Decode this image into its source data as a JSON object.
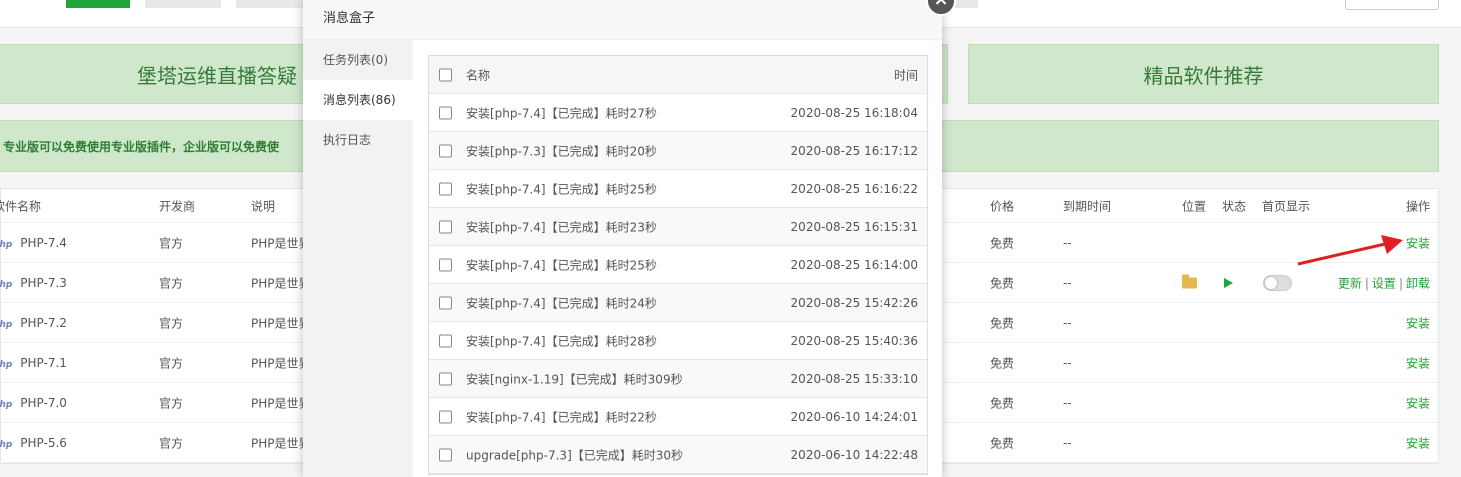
{
  "banners": {
    "left": "堡塔运维直播答疑",
    "right": "精品软件推荐"
  },
  "notice": "专业版可以免费使用专业版插件，企业版可以免费使",
  "soft_table": {
    "headers": {
      "name": "软件名称",
      "dev": "开发商",
      "desc": "说明",
      "price": "价格",
      "expire": "到期时间",
      "position": "位置",
      "status": "状态",
      "home": "首页显示",
      "op": "操作"
    },
    "rows": [
      {
        "logo": "php",
        "name": "PHP-7.4",
        "dev": "官方",
        "desc": "PHP是世界",
        "price": "免费",
        "expire": "--",
        "op": "安装"
      },
      {
        "logo": "php",
        "name": "PHP-7.3",
        "dev": "官方",
        "desc": "PHP是世界",
        "price": "免费",
        "expire": "--",
        "op_update": "更新",
        "op_settings": "设置",
        "op_uninstall": "卸载",
        "sep": "|"
      },
      {
        "logo": "php",
        "name": "PHP-7.2",
        "dev": "官方",
        "desc": "PHP是世界",
        "price": "免费",
        "expire": "--",
        "op": "安装"
      },
      {
        "logo": "php",
        "name": "PHP-7.1",
        "dev": "官方",
        "desc": "PHP是世界",
        "price": "免费",
        "expire": "--",
        "op": "安装"
      },
      {
        "logo": "php",
        "name": "PHP-7.0",
        "dev": "官方",
        "desc": "PHP是世界",
        "price": "免费",
        "expire": "--",
        "op": "安装"
      },
      {
        "logo": "php",
        "name": "PHP-5.6",
        "dev": "官方",
        "desc": "PHP是世界",
        "price": "免费",
        "expire": "--",
        "op": "安装"
      }
    ]
  },
  "modal": {
    "title": "消息盒子",
    "close": "×",
    "tabs": [
      "任务列表(0)",
      "消息列表(86)",
      "执行日志"
    ],
    "active_tab": 1,
    "table": {
      "header_name": "名称",
      "header_time": "时间",
      "rows": [
        {
          "name": "安装[php-7.4]【已完成】耗时27秒",
          "time": "2020-08-25 16:18:04"
        },
        {
          "name": "安装[php-7.3]【已完成】耗时20秒",
          "time": "2020-08-25 16:17:12"
        },
        {
          "name": "安装[php-7.4]【已完成】耗时25秒",
          "time": "2020-08-25 16:16:22"
        },
        {
          "name": "安装[php-7.4]【已完成】耗时23秒",
          "time": "2020-08-25 16:15:31"
        },
        {
          "name": "安装[php-7.4]【已完成】耗时25秒",
          "time": "2020-08-25 16:14:00"
        },
        {
          "name": "安装[php-7.4]【已完成】耗时24秒",
          "time": "2020-08-25 15:42:26"
        },
        {
          "name": "安装[php-7.4]【已完成】耗时28秒",
          "time": "2020-08-25 15:40:36"
        },
        {
          "name": "安装[nginx-1.19]【已完成】耗时309秒",
          "time": "2020-08-25 15:33:10"
        },
        {
          "name": "安装[php-7.4]【已完成】耗时22秒",
          "time": "2020-06-10 14:24:01"
        },
        {
          "name": "upgrade[php-7.3]【已完成】耗时30秒",
          "time": "2020-06-10 14:22:48"
        }
      ]
    }
  }
}
